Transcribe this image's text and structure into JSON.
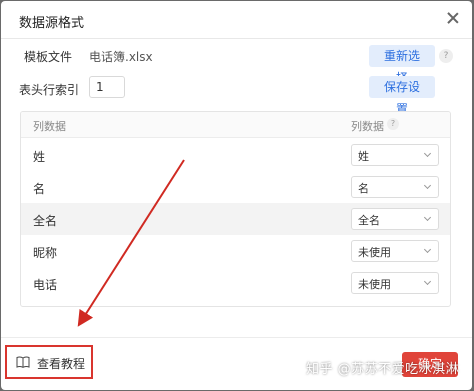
{
  "dialog": {
    "title": "数据源格式"
  },
  "template_row": {
    "label": "模板文件",
    "file_name": "电话簿.xlsx",
    "button": "重新选择",
    "help": "?"
  },
  "header_row": {
    "label": "表头行索引",
    "value": "1",
    "button": "保存设置"
  },
  "table": {
    "headers": {
      "left": "列数据",
      "right": "列数据",
      "right_help": "?"
    },
    "rows": [
      {
        "name": "姓",
        "mapping": "姓"
      },
      {
        "name": "名",
        "mapping": "名"
      },
      {
        "name": "全名",
        "mapping": "全名"
      },
      {
        "name": "昵称",
        "mapping": "未使用"
      },
      {
        "name": "电话",
        "mapping": "未使用"
      }
    ]
  },
  "footer": {
    "tutorial": "查看教程",
    "confirm": "确定"
  },
  "watermark": "知乎 @苏苏不爱吃冰淇淋",
  "colors": {
    "accent_blue": "#2d6fdf",
    "confirm_red": "#e0443a",
    "highlight_border": "#d9352e",
    "arrow": "#d02a22"
  }
}
